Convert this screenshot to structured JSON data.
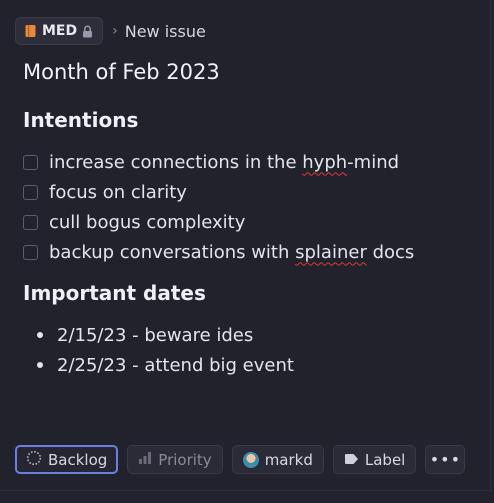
{
  "header": {
    "team_label": "MED",
    "team_icon": "book-icon",
    "lock_icon": "lock-icon",
    "separator": "›",
    "crumb": "New issue"
  },
  "issue": {
    "title": "Month of Feb 2023",
    "intentions_heading": "Intentions",
    "tasks": [
      {
        "before": "increase connections in the ",
        "misspelled": "hyph",
        "after": "-mind",
        "checked": false
      },
      {
        "before": "focus on clarity",
        "misspelled": "",
        "after": "",
        "checked": false
      },
      {
        "before": "cull bogus complexity",
        "misspelled": "",
        "after": "",
        "checked": false
      },
      {
        "before": "backup conversations with ",
        "misspelled": "splainer",
        "after": " docs",
        "checked": false
      }
    ],
    "dates_heading": "Important dates",
    "dates": [
      "2/15/23 - beware ides",
      "2/25/23 - attend big event"
    ]
  },
  "toolbar": {
    "status_label": "Backlog",
    "priority_label": "Priority",
    "assignee_label": "markd",
    "label_label": "Label",
    "more_label": "•••"
  },
  "colors": {
    "background": "#22222d",
    "accent_focus": "#6b7fe0",
    "book_icon": "#e8893a",
    "spellcheck": "#d93b3b"
  }
}
